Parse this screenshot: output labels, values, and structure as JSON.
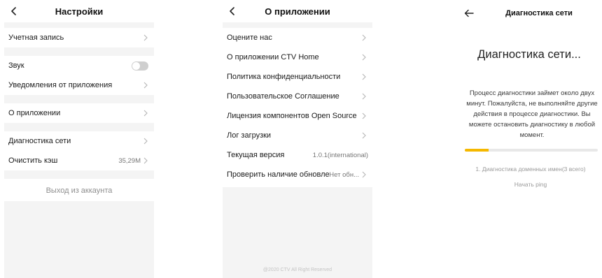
{
  "settings": {
    "title": "Настройки",
    "account": "Учетная запись",
    "sound": "Звук",
    "sound_on": false,
    "notifications": "Уведомления от приложения",
    "about": "О приложении",
    "network_diagnostics": "Диагностика сети",
    "clear_cache": "Очистить кэш",
    "cache_size": "35,29M",
    "logout": "Выход из аккаунта"
  },
  "about": {
    "title": "О приложении",
    "rate_us": "Оцените нас",
    "about_app": "О приложении CTV Home",
    "privacy_policy": "Политика конфиденциальности",
    "user_agreement": "Пользовательское Соглашение",
    "open_source": "Лицензия компонентов Open Source",
    "upload_log": "Лог загрузки",
    "current_version": "Текущая версия",
    "version_value": "1.0.1(international)",
    "check_updates": "Проверить наличие обновлений",
    "updates_status": "Нет обн...",
    "copyright": "@2020 CTV All Right Reserved"
  },
  "diagnostics": {
    "title": "Диагностика сети",
    "heading": "Диагностика сети...",
    "description": "Процесс диагностики займет около двух минут. Пожалуйста, не выполняйте другие действия в процессе диагностики. Вы можете остановить диагностику в любой момент.",
    "progress": 0.18,
    "step": "1. Диагностика доменных имен(3 всего)",
    "status": "Начать ping"
  },
  "colors": {
    "accent": "#f5b800",
    "gap": "#f4f4f4",
    "toggle_off": "#cfcfcf"
  }
}
